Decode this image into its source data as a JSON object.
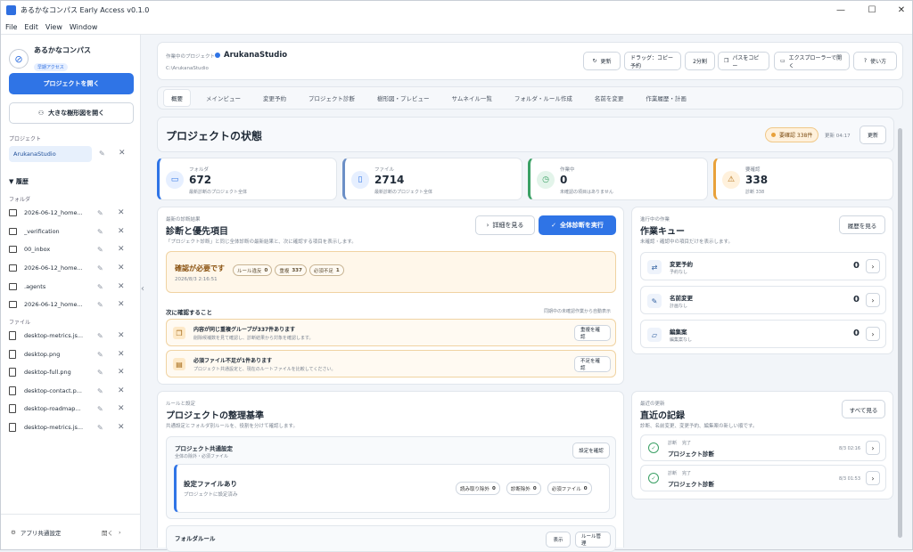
{
  "window": {
    "title": "あるかなコンパス Early Access v0.1.0"
  },
  "menu": [
    "File",
    "Edit",
    "View",
    "Window"
  ],
  "sidebar": {
    "app_name": "あるかなコンパス",
    "app_tag": "早期アクセス",
    "open_project": "プロジェクトを開く",
    "open_tree": "大きな樹形図を開く",
    "project_label": "プロジェクト",
    "current_project": "ArukanaStudio",
    "history_label": "▼ 履歴",
    "folders_label": "フォルダ",
    "folders": [
      "2026-06-12_home...",
      "_verification",
      "00_inbox",
      "2026-06-12_home...",
      ".agents",
      "2026-06-12_home..."
    ],
    "files_label": "ファイル",
    "files": [
      "desktop-metrics.js...",
      "desktop.png",
      "desktop-full.png",
      "desktop-contact.p...",
      "desktop-roadmap...",
      "desktop-metrics.js..."
    ],
    "footer_label": "アプリ共通設定",
    "footer_open": "開く"
  },
  "header": {
    "working_label": "作業中のプロジェクト",
    "project_name": "ArukanaStudio",
    "path": "C:\\ArukanaStudio",
    "buttons": {
      "refresh": "更新",
      "drag": "ドラッグ：コピー予約",
      "split": "2分割",
      "copy_path": "パスをコピー",
      "explorer": "エクスプローラーで開く",
      "help": "使い方"
    }
  },
  "tabs": [
    "概要",
    "メインビュー",
    "変更予約",
    "プロジェクト診断",
    "樹形図・プレビュー",
    "サムネイル一覧",
    "フォルダ・ルール作成",
    "名前を変更",
    "作業履歴・計画"
  ],
  "status": {
    "title": "プロジェクトの状態",
    "badge": "要確認 338件",
    "updated": "更新 04:17",
    "refresh": "更新"
  },
  "stats": [
    {
      "label": "フォルダ",
      "value": "672",
      "sub": "最新診断のプロジェクト全体"
    },
    {
      "label": "ファイル",
      "value": "2714",
      "sub": "最新診断のプロジェクト全体"
    },
    {
      "label": "作業中",
      "value": "0",
      "sub": "未確認の項目はありません"
    },
    {
      "label": "要確認",
      "value": "338",
      "sub": "診断 338"
    }
  ],
  "diag": {
    "eyebrow": "最新の診断結果",
    "title": "診断と優先項目",
    "desc": "「プロジェクト診断」と同じ全体診断の最新結果と、次に確認する項目を表示します。",
    "detail": "詳細を見る",
    "run": "全体診断を実行",
    "alert_title": "確認が必要です",
    "alert_time": "2026/8/3 2:16:51",
    "pills": [
      {
        "k": "ルール違反",
        "v": "0"
      },
      {
        "k": "重複",
        "v": "337"
      },
      {
        "k": "必須不足",
        "v": "1"
      }
    ],
    "next_label": "次に確認すること",
    "next_note": "同期中の未確認作業から自動表示",
    "items": [
      {
        "title": "内容が同じ重複グループが337件あります",
        "desc": "削除候補数を見て確認し、診断結果から対象を確認します。",
        "btn": "重複を確認"
      },
      {
        "title": "必須ファイル不足が1件あります",
        "desc": "プロジェクト共通設定と、現在のルートファイルを比較してください。",
        "btn": "不足を確認"
      }
    ]
  },
  "queue": {
    "eyebrow": "進行中の作業",
    "title": "作業キュー",
    "desc": "未確認・確認中の項目だけを表示します。",
    "history": "履歴を見る",
    "items": [
      {
        "title": "変更予約",
        "sub": "予約なし",
        "count": "0"
      },
      {
        "title": "名前変更",
        "sub": "計画なし",
        "count": "0"
      },
      {
        "title": "編集案",
        "sub": "編集案なし",
        "count": "0"
      }
    ]
  },
  "rules": {
    "eyebrow": "ルールと設定",
    "title": "プロジェクトの整理基準",
    "desc": "共通設定とフォルダ別ルールを、役割を分けて確認します。",
    "common_title": "プロジェクト共通設定",
    "common_sub": "全体の除外・必須ファイル",
    "common_btn": "設定を確認",
    "file_title": "設定ファイルあり",
    "file_sub": "プロジェクトに設定済み",
    "chips": [
      {
        "k": "読み取り除外",
        "v": "0"
      },
      {
        "k": "診断除外",
        "v": "0"
      },
      {
        "k": "必須ファイル",
        "v": "0"
      }
    ],
    "folder_rule": "フォルダルール",
    "folder_btn1": "表示",
    "folder_btn2": "ルール管理"
  },
  "recent": {
    "eyebrow": "最近の更新",
    "title": "直近の記録",
    "desc": "診断、名前変更、変更予約、編集案の新しい順です。",
    "all": "すべて見る",
    "items": [
      {
        "kind": "診断",
        "state": "完了",
        "title": "プロジェクト診断",
        "time": "8/3 02:16"
      },
      {
        "kind": "診断",
        "state": "完了",
        "title": "プロジェクト診断",
        "time": "8/3 01:53"
      }
    ]
  },
  "colors": {
    "accent": "#2f74e6",
    "warn": "#e8a13a",
    "ok": "#3aa064"
  }
}
